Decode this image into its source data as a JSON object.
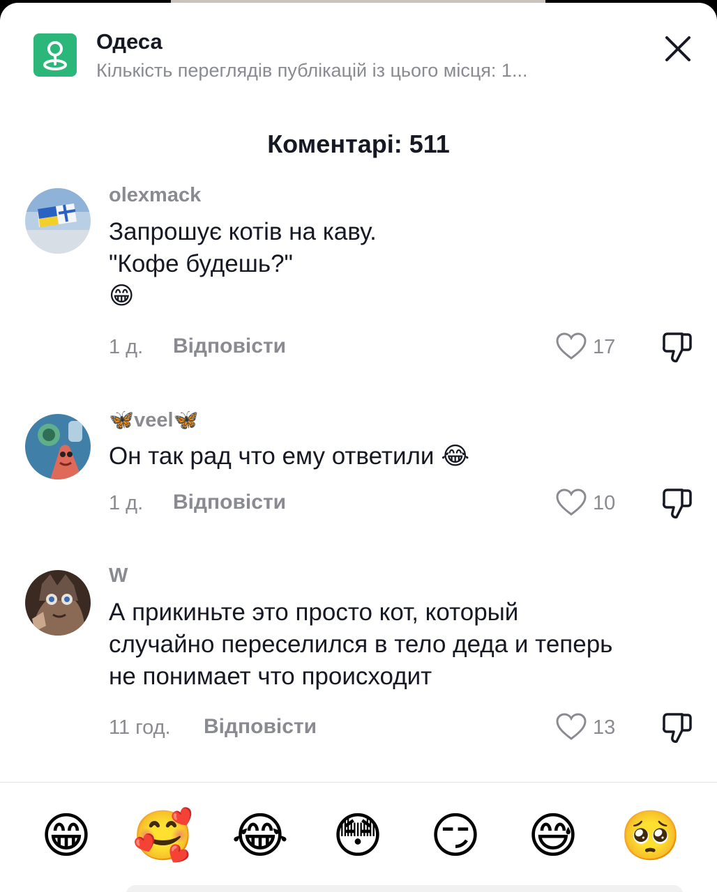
{
  "location": {
    "name": "Одеса",
    "subtitle": "Кількість переглядів публікацій із цього місця: 1..."
  },
  "comments_header": "Коментарі: 511",
  "comments": [
    {
      "username": "olexmack",
      "lines": [
        "Запрошує котів на каву.",
        "\"Кофе будешь?\"",
        "😁"
      ],
      "time": "1 д.",
      "reply_label": "Відповісти",
      "likes": "17"
    },
    {
      "username": "🦋veel🦋",
      "lines": [
        "Он так рад что ему ответили 😂"
      ],
      "time": "1 д.",
      "reply_label": "Відповісти",
      "likes": "10"
    },
    {
      "username": "W",
      "lines": [
        "А прикиньте это просто кот, который",
        "случайно переселился в тело деда и теперь",
        "не понимает что происходит"
      ],
      "time": "11 год.",
      "reply_label": "Відповісти",
      "likes": "13"
    }
  ],
  "emoji_bar": [
    "😁",
    "🥰",
    "😂",
    "😳",
    "😏",
    "😅",
    "🥺"
  ],
  "icons": {
    "location": "map-pin-icon",
    "close": "close-icon",
    "like": "heart-outline-icon",
    "dislike": "thumbs-down-icon"
  },
  "colors": {
    "location_badge": "#2bb67a",
    "text_primary": "#161823",
    "text_secondary": "#8a8b91"
  }
}
